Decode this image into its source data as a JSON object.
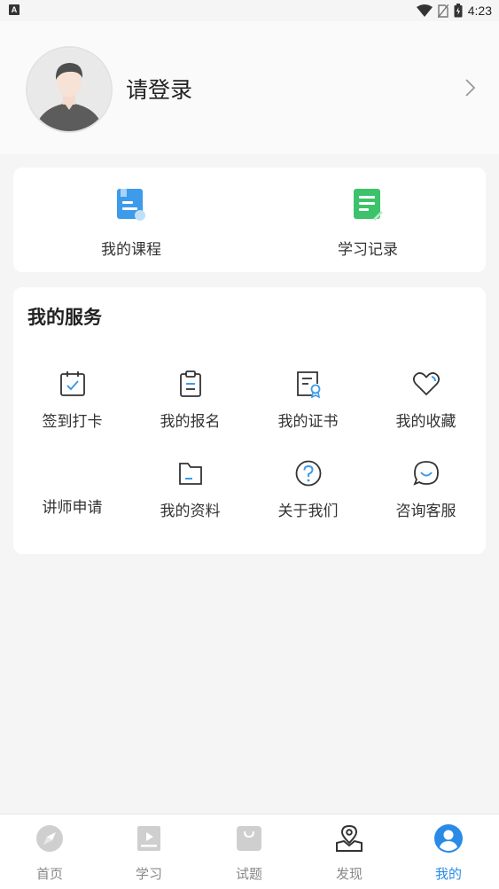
{
  "status_bar": {
    "time": "4:23"
  },
  "profile": {
    "login_text": "请登录"
  },
  "quick_links": [
    {
      "label": "我的课程",
      "icon": "course-book-icon",
      "color": "#3d9be9"
    },
    {
      "label": "学习记录",
      "icon": "study-record-icon",
      "color": "#3cc26b"
    }
  ],
  "services": {
    "title": "我的服务",
    "items": [
      {
        "label": "签到打卡",
        "icon": "calendar-check-icon"
      },
      {
        "label": "我的报名",
        "icon": "clipboard-icon"
      },
      {
        "label": "我的证书",
        "icon": "certificate-icon"
      },
      {
        "label": "我的收藏",
        "icon": "heart-icon"
      },
      {
        "label": "讲师申请",
        "icon": ""
      },
      {
        "label": "我的资料",
        "icon": "folder-icon"
      },
      {
        "label": "关于我们",
        "icon": "question-circle-icon"
      },
      {
        "label": "咨询客服",
        "icon": "chat-bubble-icon"
      }
    ]
  },
  "tabbar": {
    "active": "我的",
    "accent_color": "#2a8be6",
    "tabs": [
      {
        "label": "首页",
        "icon": "compass-icon"
      },
      {
        "label": "学习",
        "icon": "video-book-icon"
      },
      {
        "label": "试题",
        "icon": "shopping-bag-icon"
      },
      {
        "label": "发现",
        "icon": "map-pin-icon"
      },
      {
        "label": "我的",
        "icon": "user-circle-icon"
      }
    ]
  }
}
